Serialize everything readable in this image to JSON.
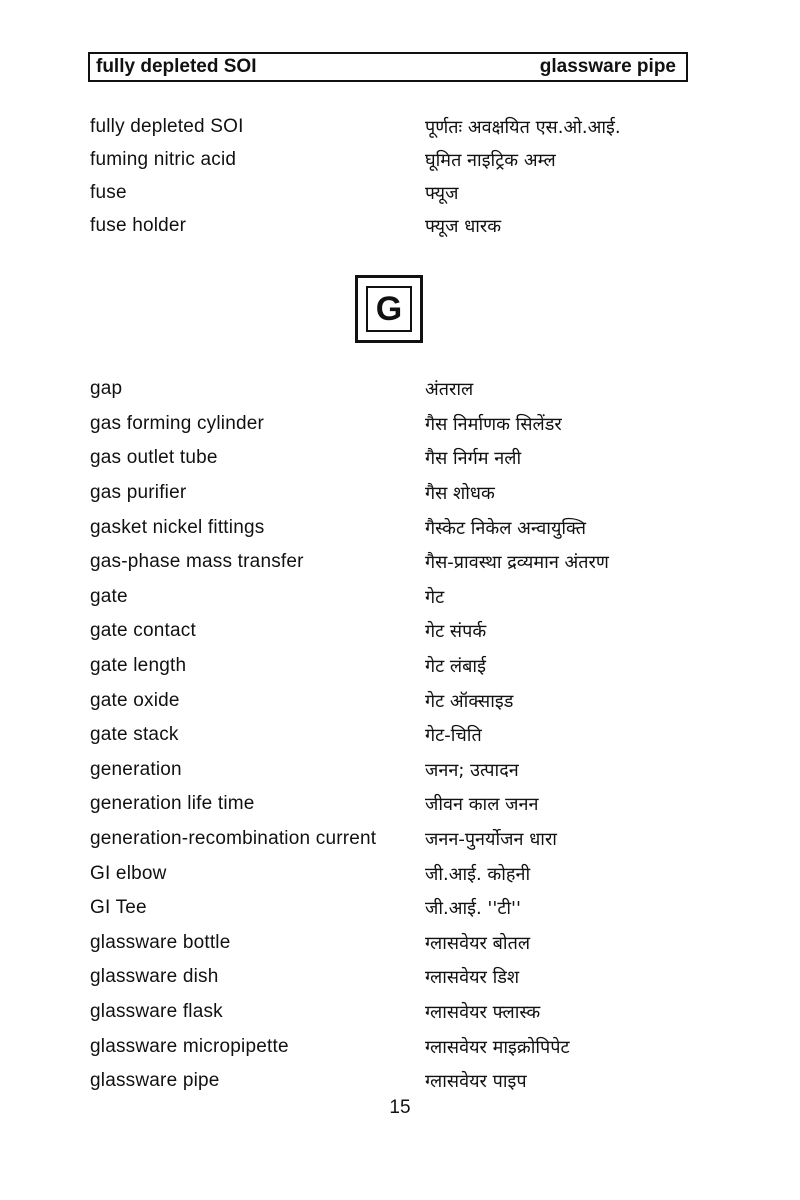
{
  "header": {
    "left": "fully depleted SOI",
    "right": "glassware pipe"
  },
  "section_f": [
    {
      "en": "fully depleted SOI",
      "hi": "पूर्णतः अवक्षयित एस.ओ.आई."
    },
    {
      "en": "fuming nitric acid",
      "hi": "घूमित नाइट्रिक अम्ल"
    },
    {
      "en": "fuse",
      "hi": "फ्यूज"
    },
    {
      "en": "fuse holder",
      "hi": "फ्यूज धारक"
    }
  ],
  "section_letter": "G",
  "section_g": [
    {
      "en": "gap",
      "hi": "अंतराल"
    },
    {
      "en": "gas forming cylinder",
      "hi": "गैस निर्माणक सिलेंडर"
    },
    {
      "en": "gas outlet tube",
      "hi": "गैस निर्गम नली"
    },
    {
      "en": "gas purifier",
      "hi": "गैस शोधक"
    },
    {
      "en": "gasket nickel fittings",
      "hi": "गैस्केट निकेल अन्वायुक्ति"
    },
    {
      "en": "gas-phase mass transfer",
      "hi": "गैस-प्रावस्था द्रव्यमान अंतरण"
    },
    {
      "en": "gate",
      "hi": "गेट"
    },
    {
      "en": "gate contact",
      "hi": "गेट संपर्क"
    },
    {
      "en": "gate length",
      "hi": "गेट लंबाई"
    },
    {
      "en": "gate oxide",
      "hi": "गेट ऑक्साइड"
    },
    {
      "en": "gate stack",
      "hi": "गेट-चिति"
    },
    {
      "en": "generation",
      "hi": "जनन; उत्पादन"
    },
    {
      "en": "generation life time",
      "hi": "जीवन काल जनन"
    },
    {
      "en": "generation-recombination current",
      "hi": "जनन-पुनर्योजन धारा"
    },
    {
      "en": "GI elbow",
      "hi": "जी.आई. कोहनी"
    },
    {
      "en": "GI Tee",
      "hi": "जी.आई. ''टी''"
    },
    {
      "en": "glassware bottle",
      "hi": "ग्लासवेयर बोतल"
    },
    {
      "en": "glassware dish",
      "hi": "ग्लासवेयर डिश"
    },
    {
      "en": "glassware flask",
      "hi": "ग्लासवेयर फ्लास्क"
    },
    {
      "en": "glassware micropipette",
      "hi": "ग्लासवेयर माइक्रोपिपेट"
    },
    {
      "en": "glassware pipe",
      "hi": "ग्लासवेयर पाइप"
    }
  ],
  "page_number": "15"
}
